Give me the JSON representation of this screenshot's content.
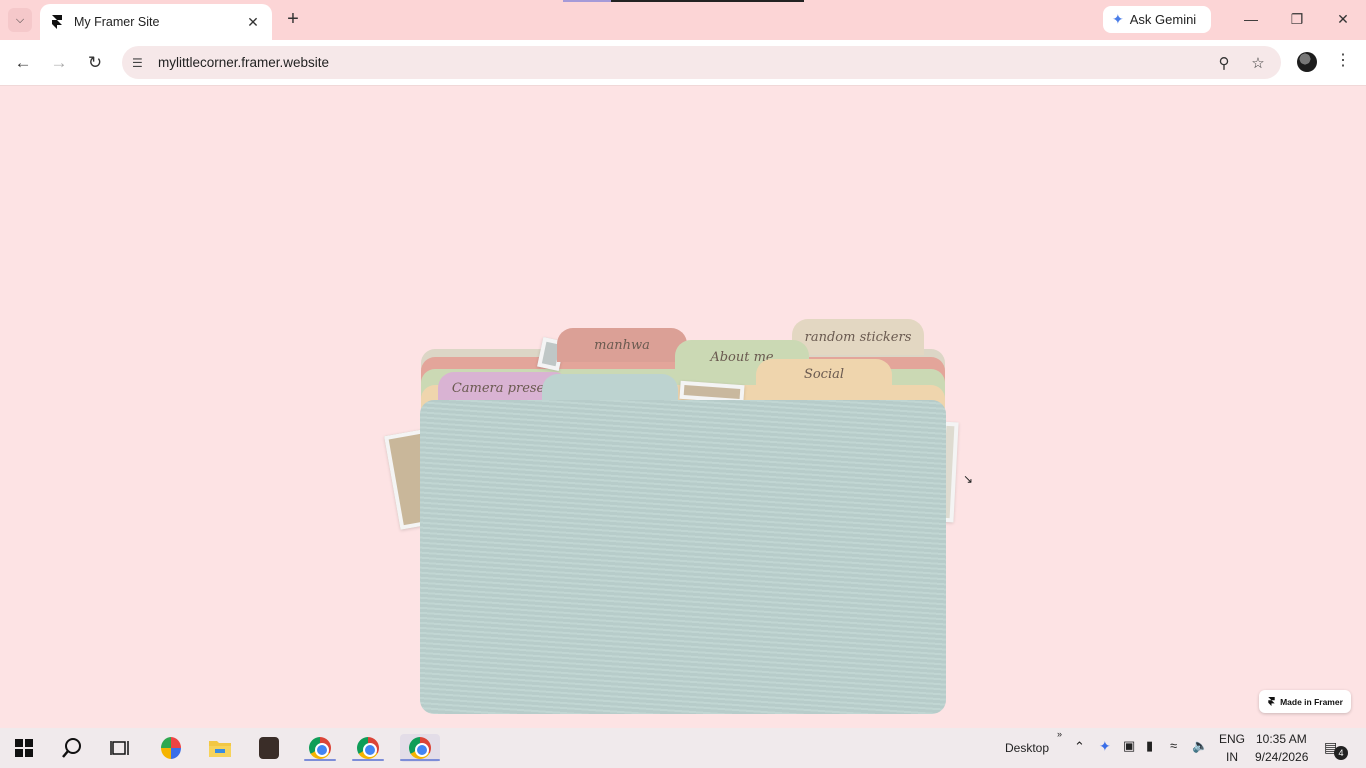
{
  "browser": {
    "tab_title": "My Framer Site",
    "url": "mylittlecorner.framer.website",
    "ask_gemini_label": "Ask Gemini"
  },
  "folder_tabs": [
    {
      "label": "manhwa",
      "color": "#dba096"
    },
    {
      "label": "About me",
      "color": "#cbd9b4"
    },
    {
      "label": "random stickers",
      "color": "#e3d7c2"
    },
    {
      "label": "Social",
      "color": "#efd5ad"
    },
    {
      "label": "Camera presets",
      "color": "#d9b3d3"
    }
  ],
  "front_folder_color": "#bdd3d0",
  "badge": {
    "label": "Made in Framer"
  },
  "taskbar": {
    "desktop_label": "Desktop",
    "lang_line1": "ENG",
    "lang_line2": "IN",
    "time": "10:35 AM",
    "date": "9/24/2026",
    "notification_count": "4"
  }
}
